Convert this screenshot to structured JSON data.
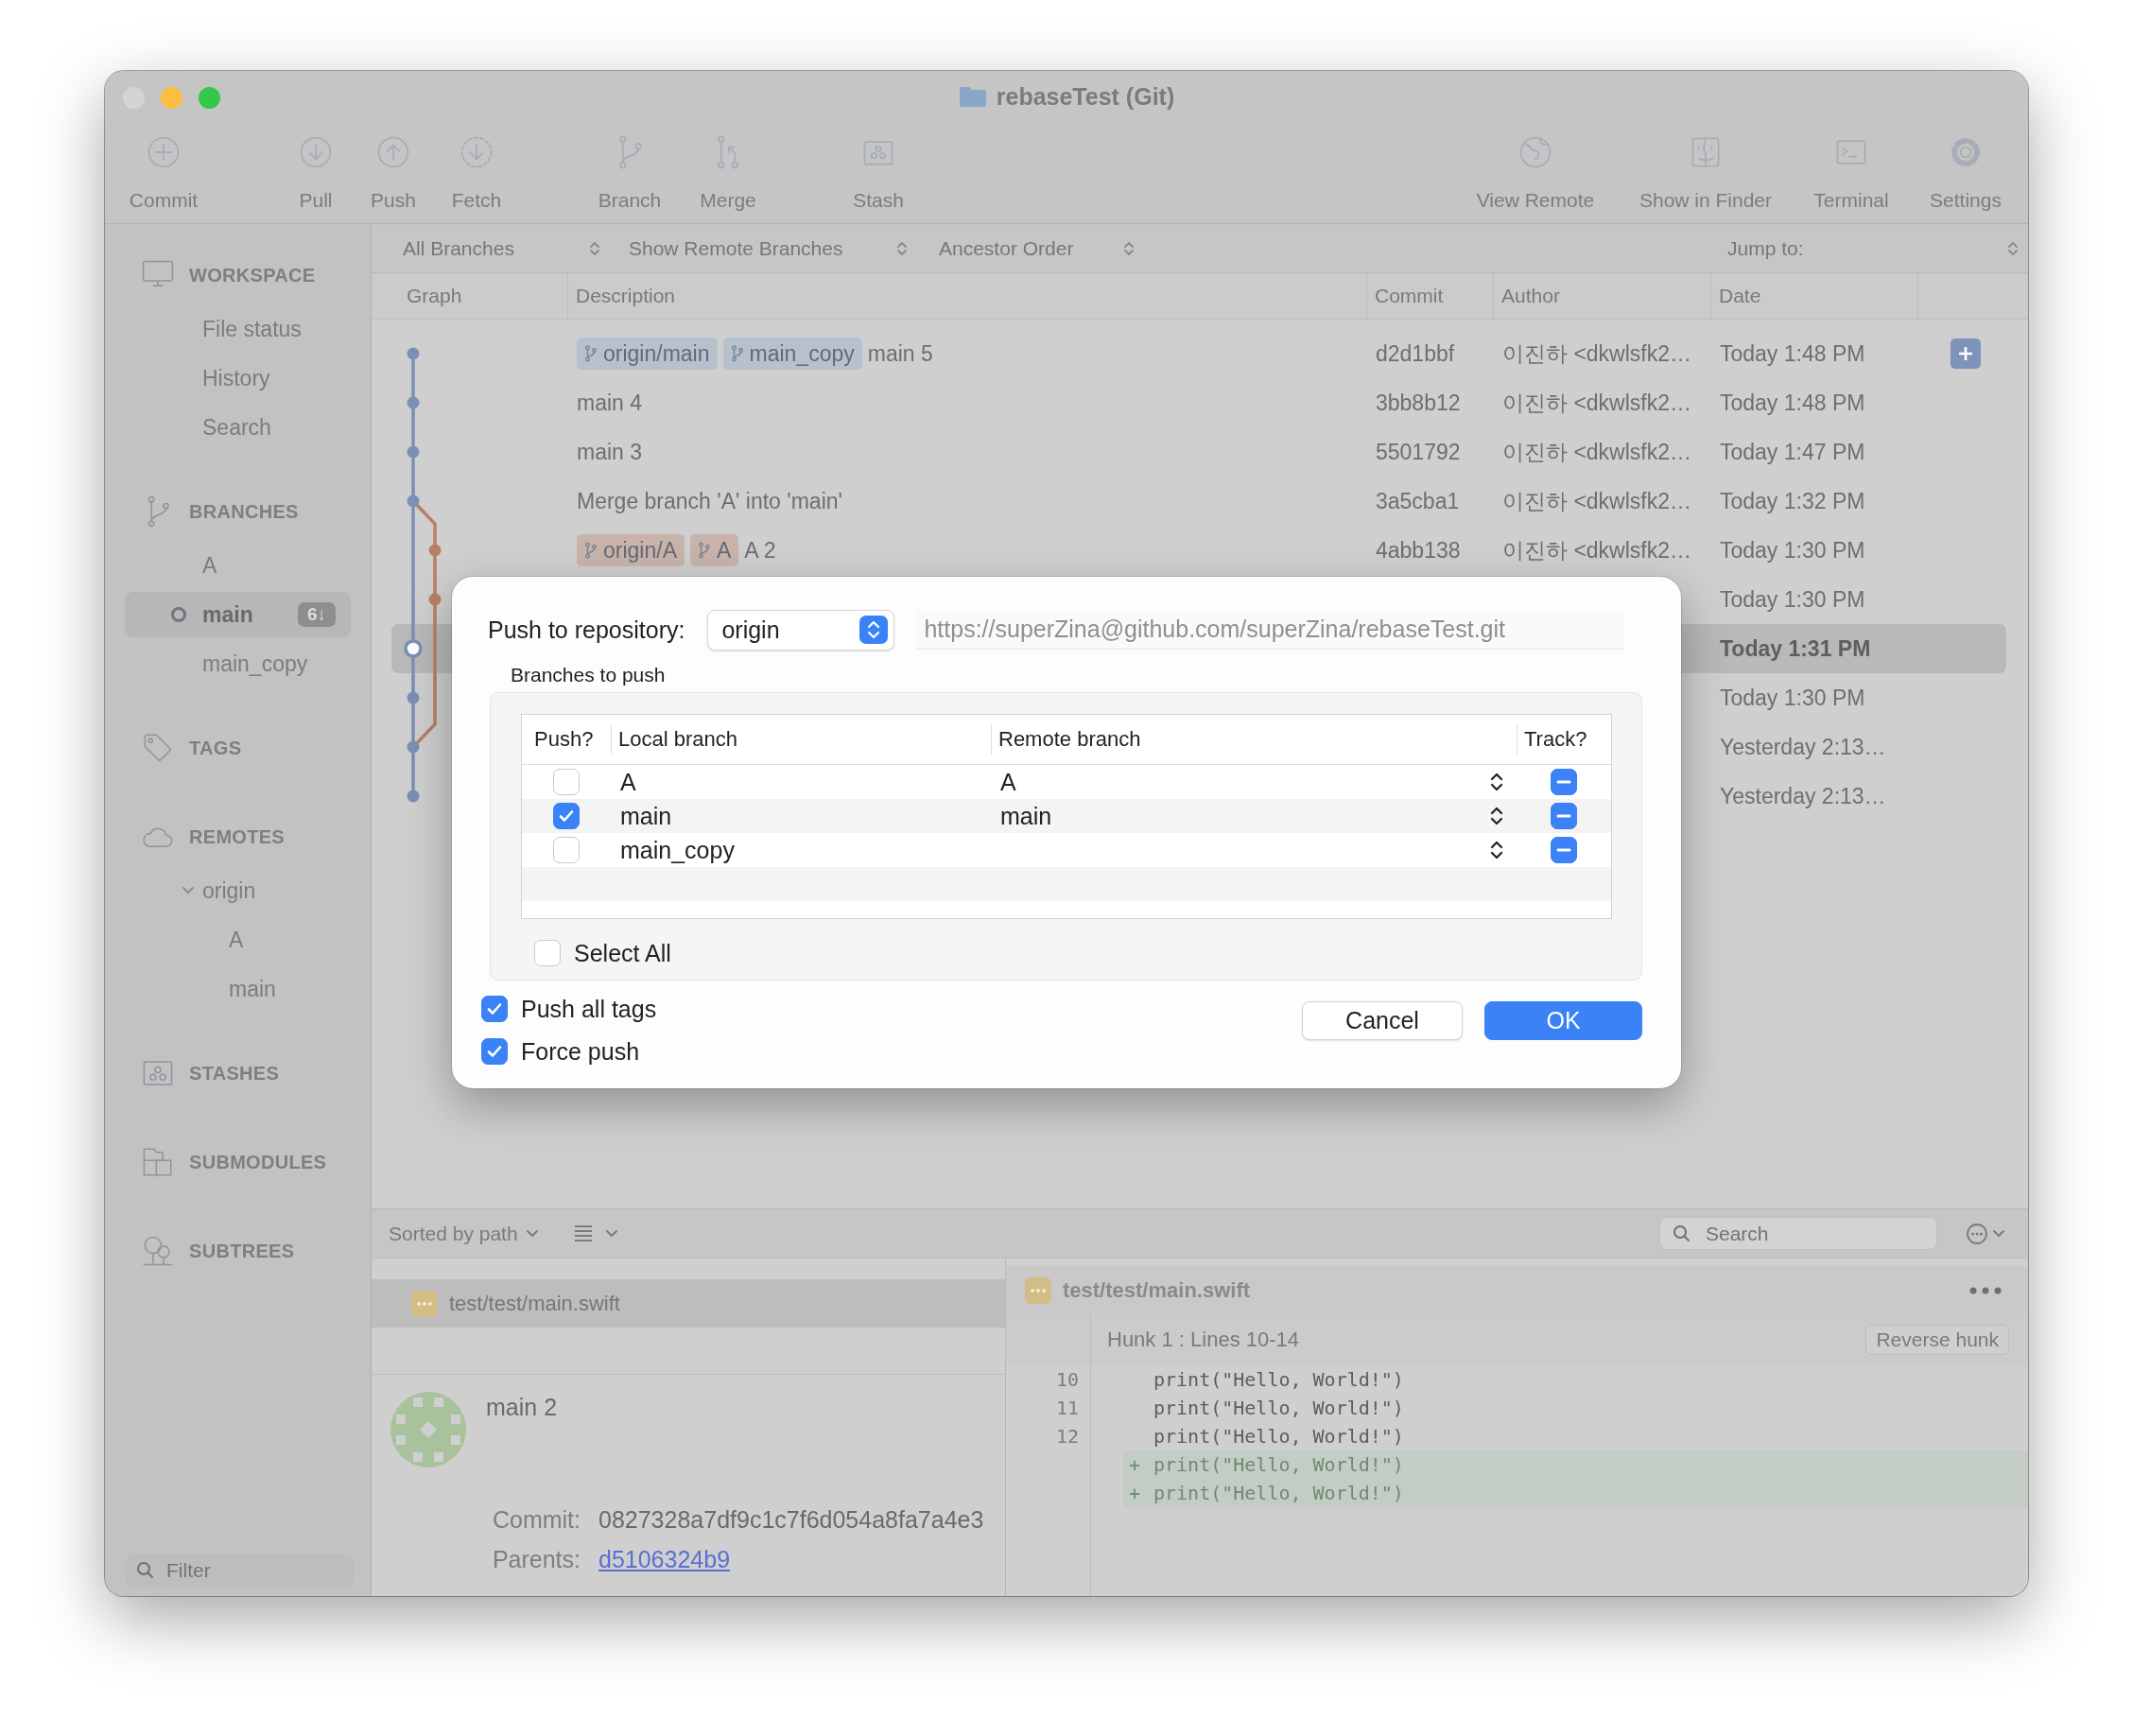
{
  "window": {
    "title": "rebaseTest (Git)"
  },
  "toolbar": [
    {
      "label": "Commit"
    },
    {
      "label": "Pull"
    },
    {
      "label": "Push"
    },
    {
      "label": "Fetch"
    },
    {
      "label": "Branch"
    },
    {
      "label": "Merge"
    },
    {
      "label": "Stash"
    },
    {
      "label": "View Remote"
    },
    {
      "label": "Show in Finder"
    },
    {
      "label": "Terminal"
    },
    {
      "label": "Settings"
    }
  ],
  "sidebar": {
    "sections": [
      {
        "title": "WORKSPACE",
        "items": [
          {
            "label": "File status",
            "selected": false
          },
          {
            "label": "History",
            "selected": false
          },
          {
            "label": "Search",
            "selected": false
          }
        ]
      },
      {
        "title": "BRANCHES",
        "items": [
          {
            "label": "A",
            "selected": false,
            "current": false
          },
          {
            "label": "main",
            "selected": true,
            "current": true,
            "badge": "6↓"
          },
          {
            "label": "main_copy",
            "selected": false,
            "current": false
          }
        ]
      },
      {
        "title": "TAGS"
      },
      {
        "title": "REMOTES",
        "items": [
          {
            "label": "origin",
            "selected": false,
            "expanded": true,
            "children": [
              {
                "label": "A",
                "selected": false
              },
              {
                "label": "main",
                "selected": false
              }
            ]
          }
        ]
      },
      {
        "title": "STASHES"
      },
      {
        "title": "SUBMODULES"
      },
      {
        "title": "SUBTREES"
      }
    ],
    "filter": {
      "placeholder": "Filter"
    }
  },
  "history": {
    "filters": [
      {
        "label": "All Branches"
      },
      {
        "label": "Show Remote Branches"
      },
      {
        "label": "Ancestor Order"
      }
    ],
    "jump_to": {
      "label": "Jump to:"
    },
    "columns": [
      "Graph",
      "Description",
      "Commit",
      "Author",
      "Date"
    ],
    "rows": [
      {
        "tags": [
          {
            "label": "origin/main",
            "color": "#b7c0cd"
          },
          {
            "label": "main_copy",
            "color": "#b7c0cd"
          }
        ],
        "description": "main 5",
        "commit": "d2d1bbf",
        "author": "이진하 <dkwlsfk2…",
        "date": "Today 1:48 PM",
        "selected": false,
        "add_button": true
      },
      {
        "description": "main 4",
        "commit": "3bb8b12",
        "author": "이진하 <dkwlsfk2…",
        "date": "Today 1:48 PM",
        "selected": false
      },
      {
        "description": "main 3",
        "commit": "5501792",
        "author": "이진하 <dkwlsfk2…",
        "date": "Today 1:47 PM",
        "selected": false
      },
      {
        "description": "Merge branch 'A' into 'main'",
        "commit": "3a5cba1",
        "author": "이진하 <dkwlsfk2…",
        "date": "Today 1:32 PM",
        "selected": false
      },
      {
        "tags": [
          {
            "label": "origin/A",
            "color": "#c9b4ac"
          },
          {
            "label": "A",
            "color": "#c9b4ac"
          }
        ],
        "description": "A 2",
        "commit": "4abb138",
        "author": "이진하 <dkwlsfk2…",
        "date": "Today 1:30 PM",
        "selected": false
      },
      {
        "date": "Today 1:30 PM",
        "selected": false
      },
      {
        "date": "Today 1:31 PM",
        "selected": true
      },
      {
        "date": "Today 1:30 PM",
        "selected": false
      },
      {
        "date": "Yesterday 2:13…",
        "selected": false
      },
      {
        "date": "Yesterday 2:13…",
        "selected": false
      }
    ]
  },
  "push_dialog": {
    "repository_label": "Push to repository:",
    "repository": "origin",
    "url": "https://superZina@github.com/superZina/rebaseTest.git",
    "group_label": "Branches to push",
    "columns": [
      "Push?",
      "Local branch",
      "Remote branch",
      "Track?"
    ],
    "branches": [
      {
        "local": "A",
        "remote": "A",
        "push": false,
        "track": true,
        "track_mixed": true
      },
      {
        "local": "main",
        "remote": "main",
        "push": true,
        "track": true,
        "track_mixed": true
      },
      {
        "local": "main_copy",
        "push": false,
        "track": true,
        "track_mixed": true
      }
    ],
    "select_all": {
      "label": "Select All",
      "checked": false
    },
    "options": [
      {
        "label": "Push all tags",
        "checked": true
      },
      {
        "label": "Force push",
        "checked": true
      }
    ],
    "buttons": [
      {
        "label": "Cancel",
        "kind": "secondary"
      },
      {
        "label": "OK",
        "kind": "primary"
      }
    ]
  },
  "files": {
    "sort": "Sorted by path",
    "items": [
      {
        "path": "test/test/main.swift",
        "selected": true
      }
    ]
  },
  "commit_details": {
    "subject": "main 2",
    "fields": [
      {
        "label": "Commit:",
        "value": "0827328a7df9c1c7f6d054a8fa7a4e3",
        "kind": "text"
      },
      {
        "label": "Parents:",
        "value": "d5106324b9",
        "kind": "link"
      }
    ]
  },
  "diff": {
    "search": {
      "placeholder": "Search"
    },
    "file": "test/test/main.swift",
    "hunk": "Hunk 1 : Lines 10-14",
    "reverse_button": "Reverse hunk",
    "lines": [
      {
        "number": "10",
        "text": "print(\"Hello, World!\")",
        "kind": "context"
      },
      {
        "number": "11",
        "text": "print(\"Hello, World!\")",
        "kind": "context"
      },
      {
        "number": "12",
        "text": "print(\"Hello, World!\")",
        "kind": "context"
      },
      {
        "marker": "+",
        "text": "print(\"Hello, World!\")",
        "kind": "added"
      },
      {
        "marker": "+",
        "text": "print(\"Hello, World!\")",
        "kind": "added"
      }
    ]
  }
}
